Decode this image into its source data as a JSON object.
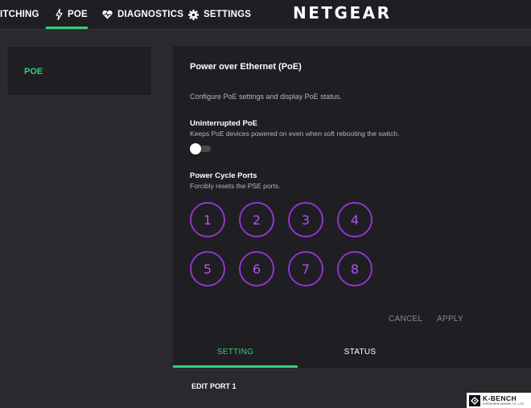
{
  "nav": {
    "items": [
      {
        "label": "ITCHING",
        "icon": "none"
      },
      {
        "label": "POE",
        "icon": "lightning-icon"
      },
      {
        "label": "DIAGNOSTICS",
        "icon": "heartbeat-icon"
      },
      {
        "label": "SETTINGS",
        "icon": "gear-icon"
      }
    ],
    "active_index": 1,
    "brand": "NETGEAR"
  },
  "sidebar": {
    "items": [
      {
        "label": "POE"
      }
    ]
  },
  "main": {
    "title": "Power over Ethernet (PoE)",
    "description": "Configure PoE settings and display PoE status.",
    "uninterrupted": {
      "title": "Uninterrupted PoE",
      "description": "Keeps PoE devices powered on even when soft rebooting the switch.",
      "enabled": false
    },
    "power_cycle": {
      "title": "Power Cycle Ports",
      "description": "Forcibly resets the PSE ports.",
      "ports": [
        "1",
        "2",
        "3",
        "4",
        "5",
        "6",
        "7",
        "8"
      ]
    },
    "actions": {
      "cancel": "CANCEL",
      "apply": "APPLY"
    },
    "tabs": [
      {
        "label": "SETTING"
      },
      {
        "label": "STATUS"
      }
    ],
    "active_tab": 0,
    "edit_title": "EDIT PORT 1"
  },
  "colors": {
    "accent_green": "#33d17a",
    "port_purple": "#8e35cf",
    "panel_bg": "#1f1e22",
    "page_bg": "#2a292d"
  },
  "watermark": {
    "title": "K-BENCH",
    "subtitle": "KOREA BENCHMARK CO., LTD."
  }
}
